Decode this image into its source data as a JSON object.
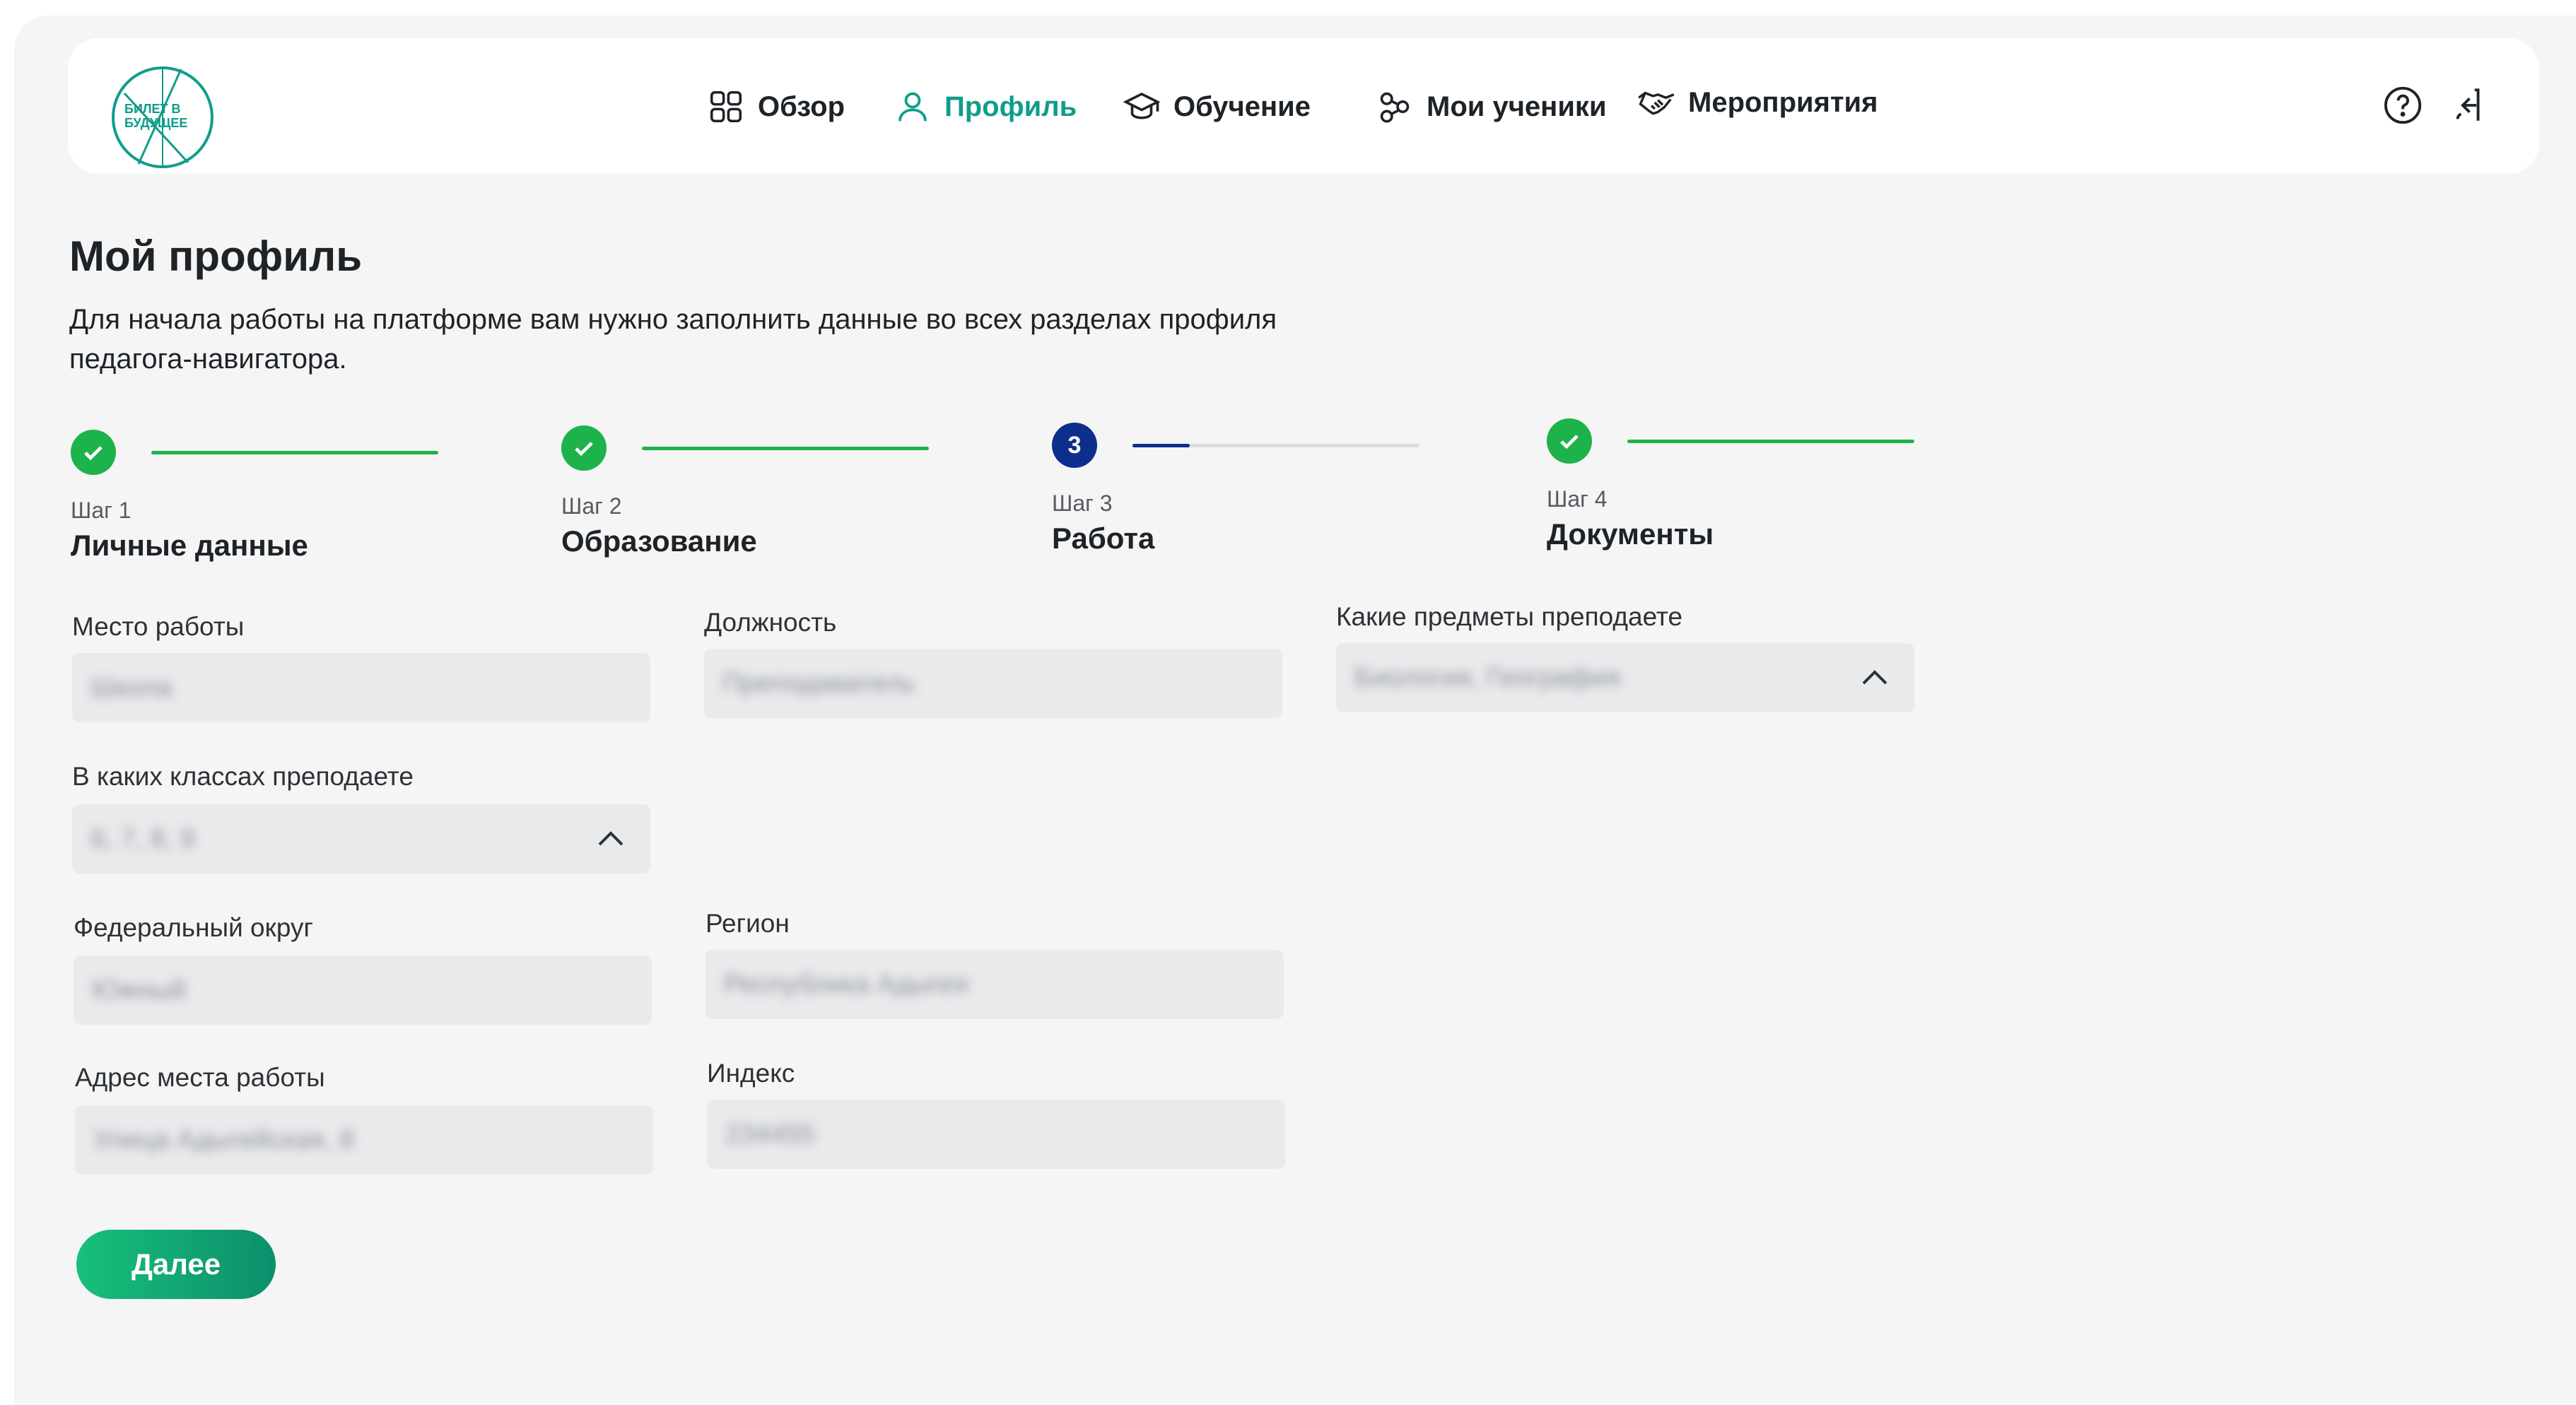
{
  "logo": {
    "line1": "БИЛЕТ В",
    "line2": "БУДУЩЕЕ"
  },
  "nav": [
    {
      "label": "Обзор",
      "icon": "grid-icon",
      "active": false
    },
    {
      "label": "Профиль",
      "icon": "user-icon",
      "active": true
    },
    {
      "label": "Обучение",
      "icon": "graduation-cap-icon",
      "active": false
    },
    {
      "label": "Мои ученики",
      "icon": "students-icon",
      "active": false
    },
    {
      "label": "Мероприятия",
      "icon": "handshake-icon",
      "active": false
    }
  ],
  "header_icons": [
    "help-icon",
    "logout-icon"
  ],
  "page": {
    "title": "Мой профиль",
    "intro": "Для начала работы на платформе вам  нужно заполнить данные во всех  разделах профиля педагога-навигатора."
  },
  "steps": [
    {
      "num": "Шаг 1",
      "name": "Личные данные",
      "status": "done"
    },
    {
      "num": "Шаг 2",
      "name": "Образование",
      "status": "done"
    },
    {
      "num": "Шаг 3",
      "name": "Работа",
      "status": "current",
      "badge": "3",
      "progress": 0.2
    },
    {
      "num": "Шаг 4",
      "name": "Документы",
      "status": "done"
    }
  ],
  "form": {
    "workplace": {
      "label": "Место работы",
      "value": "Школа"
    },
    "position": {
      "label": "Должность",
      "value": "Преподаватель"
    },
    "subjects": {
      "label": "Какие предметы преподаете",
      "value": "Биология, География"
    },
    "grades": {
      "label": "В каких классах преподаете",
      "value": "6, 7, 8, 9"
    },
    "district": {
      "label": "Федеральный округ",
      "value": "Южный"
    },
    "region": {
      "label": "Регион",
      "value": "Республика Адыгея"
    },
    "address": {
      "label": "Адрес места работы",
      "value": "Улица Адыгейская, 8"
    },
    "index": {
      "label": "Индекс",
      "value": "234455"
    }
  },
  "next_button": "Далее",
  "colors": {
    "accent": "#0f9d8a",
    "success": "#1db34a",
    "current_step": "#0d2f8c"
  }
}
